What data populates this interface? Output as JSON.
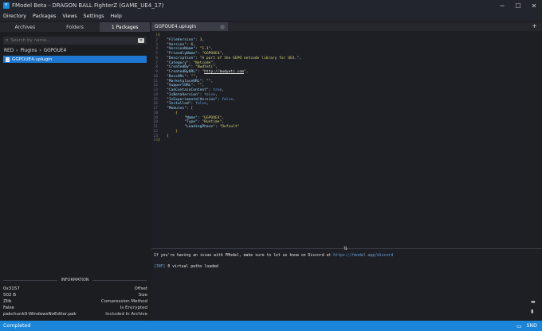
{
  "window": {
    "title": "FModel Beta - DRAGON BALL FighterZ (GAME_UE4_17)",
    "icon": "fmodel-app-icon",
    "controls": [
      "─",
      "☐",
      "✕"
    ]
  },
  "menu": [
    "Directory",
    "Packages",
    "Views",
    "Settings",
    "Help"
  ],
  "left": {
    "tabs": [
      {
        "label": "Archives",
        "active": false
      },
      {
        "label": "Folders",
        "active": false
      },
      {
        "label": "1 Packages",
        "active": true
      }
    ],
    "search": {
      "placeholder": "Search by name...",
      "clear_icon": "clear-icon"
    },
    "breadcrumb": [
      "RED",
      "›",
      "Plugins",
      "›",
      "GGPOUE4"
    ],
    "files": [
      {
        "name": "GGPOUE4.uplugin",
        "selected": true
      }
    ],
    "information": {
      "header": "INFORMATION",
      "rows": [
        {
          "value": "0x3157",
          "key": "Offset"
        },
        {
          "value": "502 B",
          "key": "Size"
        },
        {
          "value": "Zlib",
          "key": "Compression Method"
        },
        {
          "value": "False",
          "key": "Is Encrypted"
        },
        {
          "value": "pakchunk0-WindowsNoEditor.pak",
          "key": "Included In Archive"
        }
      ]
    }
  },
  "editor": {
    "tab": {
      "label": "GGPOUE4.uplugin"
    },
    "new_tab_label": "+",
    "line_count": 24,
    "lines": [
      [
        [
          "{",
          "p"
        ]
      ],
      [
        [
          "    ",
          ""
        ],
        [
          "\"FileVersion\"",
          "k"
        ],
        [
          ": ",
          ""
        ],
        [
          "3",
          "n"
        ],
        [
          ",",
          ""
        ]
      ],
      [
        [
          "    ",
          ""
        ],
        [
          "\"Version\"",
          "k"
        ],
        [
          ": ",
          ""
        ],
        [
          "6",
          "n"
        ],
        [
          ",",
          ""
        ]
      ],
      [
        [
          "    ",
          ""
        ],
        [
          "\"VersionName\"",
          "k"
        ],
        [
          ": ",
          ""
        ],
        [
          "\"1.1\"",
          "s"
        ],
        [
          ",",
          ""
        ]
      ],
      [
        [
          "    ",
          ""
        ],
        [
          "\"FriendlyName\"",
          "k"
        ],
        [
          ": ",
          ""
        ],
        [
          "\"GGPOUE4\"",
          "s"
        ],
        [
          ",",
          ""
        ]
      ],
      [
        [
          "    ",
          ""
        ],
        [
          "\"Description\"",
          "k"
        ],
        [
          ": ",
          ""
        ],
        [
          "\"A port of the GGPO netcode library for UE4.\"",
          "s"
        ],
        [
          ",",
          ""
        ]
      ],
      [
        [
          "    ",
          ""
        ],
        [
          "\"Category\"",
          "k"
        ],
        [
          ": ",
          ""
        ],
        [
          "\"Netcode\"",
          "s"
        ],
        [
          ",",
          ""
        ]
      ],
      [
        [
          "    ",
          ""
        ],
        [
          "\"CreatedBy\"",
          "k"
        ],
        [
          ": ",
          ""
        ],
        [
          "\"BwdYeti\"",
          "s"
        ],
        [
          ",",
          ""
        ]
      ],
      [
        [
          "    ",
          ""
        ],
        [
          "\"CreatedByURL\"",
          "k"
        ],
        [
          ": ",
          ""
        ],
        [
          "\"",
          "s"
        ],
        [
          "http://bwdyeti.com",
          "u"
        ],
        [
          "\"",
          "s"
        ],
        [
          ",",
          ""
        ]
      ],
      [
        [
          "    ",
          ""
        ],
        [
          "\"DocsURL\"",
          "k"
        ],
        [
          ": ",
          ""
        ],
        [
          "\"\"",
          "s"
        ],
        [
          ",",
          ""
        ]
      ],
      [
        [
          "    ",
          ""
        ],
        [
          "\"MarketplaceURL\"",
          "k"
        ],
        [
          ": ",
          ""
        ],
        [
          "\"\"",
          "s"
        ],
        [
          ",",
          ""
        ]
      ],
      [
        [
          "    ",
          ""
        ],
        [
          "\"SupportURL\"",
          "k"
        ],
        [
          ": ",
          ""
        ],
        [
          "\"\"",
          "s"
        ],
        [
          ",",
          ""
        ]
      ],
      [
        [
          "    ",
          ""
        ],
        [
          "\"CanContainContent\"",
          "k"
        ],
        [
          ": ",
          ""
        ],
        [
          "true",
          "b"
        ],
        [
          ",",
          ""
        ]
      ],
      [
        [
          "    ",
          ""
        ],
        [
          "\"IsBetaVersion\"",
          "k"
        ],
        [
          ": ",
          ""
        ],
        [
          "false",
          "b"
        ],
        [
          ",",
          ""
        ]
      ],
      [
        [
          "    ",
          ""
        ],
        [
          "\"IsExperimentalVersion\"",
          "k"
        ],
        [
          ": ",
          ""
        ],
        [
          "false",
          "b"
        ],
        [
          ",",
          ""
        ]
      ],
      [
        [
          "    ",
          ""
        ],
        [
          "\"Installed\"",
          "k"
        ],
        [
          ": ",
          ""
        ],
        [
          "false",
          "b"
        ],
        [
          ",",
          ""
        ]
      ],
      [
        [
          "    ",
          ""
        ],
        [
          "\"Modules\"",
          "k"
        ],
        [
          ": [",
          ""
        ]
      ],
      [
        [
          "        ",
          ""
        ],
        [
          "{",
          "p"
        ]
      ],
      [
        [
          "            ",
          ""
        ],
        [
          "\"Name\"",
          "k"
        ],
        [
          ": ",
          ""
        ],
        [
          "\"GGPOUE4\"",
          "s"
        ],
        [
          ",",
          ""
        ]
      ],
      [
        [
          "            ",
          ""
        ],
        [
          "\"Type\"",
          "k"
        ],
        [
          ": ",
          ""
        ],
        [
          "\"Runtime\"",
          "s"
        ],
        [
          ",",
          ""
        ]
      ],
      [
        [
          "            ",
          ""
        ],
        [
          "\"LoadingPhase\"",
          "k"
        ],
        [
          ": ",
          ""
        ],
        [
          "\"Default\"",
          "s"
        ]
      ],
      [
        [
          "        ",
          ""
        ],
        [
          "}",
          "p"
        ]
      ],
      [
        [
          "    ]",
          ""
        ]
      ],
      [
        [
          "}",
          "p"
        ]
      ]
    ]
  },
  "console": {
    "message_prefix": "If you're having an issue with FModel, make sure to let us know on Discord at ",
    "message_link": "https://fmodel.app/discord",
    "log_tag": "[INF]",
    "log_text": " 0 virtual paths loaded"
  },
  "status": {
    "text": "Completed",
    "right_label": "SND"
  },
  "colors": {
    "accent": "#1b86d9",
    "key": "#9cdcfe",
    "string": "#d4d47a",
    "number": "#b5cea8",
    "bool": "#6aa0d8",
    "punct": "#e8c54a",
    "url": "#e6e6e6"
  }
}
